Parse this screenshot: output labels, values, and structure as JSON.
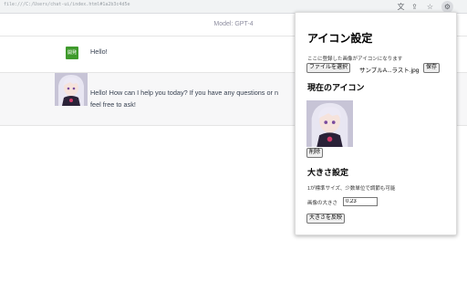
{
  "browser": {
    "url": "file:///C:/Users/chat-ui/index.html#1a2b3c4d5e",
    "icons": [
      "translate-icon",
      "share-icon",
      "star-icon",
      "extension-icon"
    ]
  },
  "chat": {
    "model_label": "Model: GPT-4",
    "user_badge": "開発",
    "user_message": "Hello!",
    "bot_message_line1": "Hello! How can I help you today? If you have any questions or n",
    "bot_message_line2": "feel free to ask!"
  },
  "popup": {
    "title": "アイコン設定",
    "hint": "ここに登録した画像がアイコンになります",
    "choose_file_label": "ファイルを選択",
    "file_name": "サンプルA...ラスト.jpg",
    "save_label": "保存",
    "current_icon_heading": "現在のアイコン",
    "delete_label": "削除",
    "size_heading": "大きさ設定",
    "size_hint": "1が標準サイズ、少数単位で調節も可能",
    "size_label": "画像の大きさ",
    "size_value": "0.23",
    "apply_size_label": "大きさを反映"
  },
  "colors": {
    "accent_user_badge": "#3f9a2c",
    "bot_row_bg": "#f7f7f8"
  }
}
